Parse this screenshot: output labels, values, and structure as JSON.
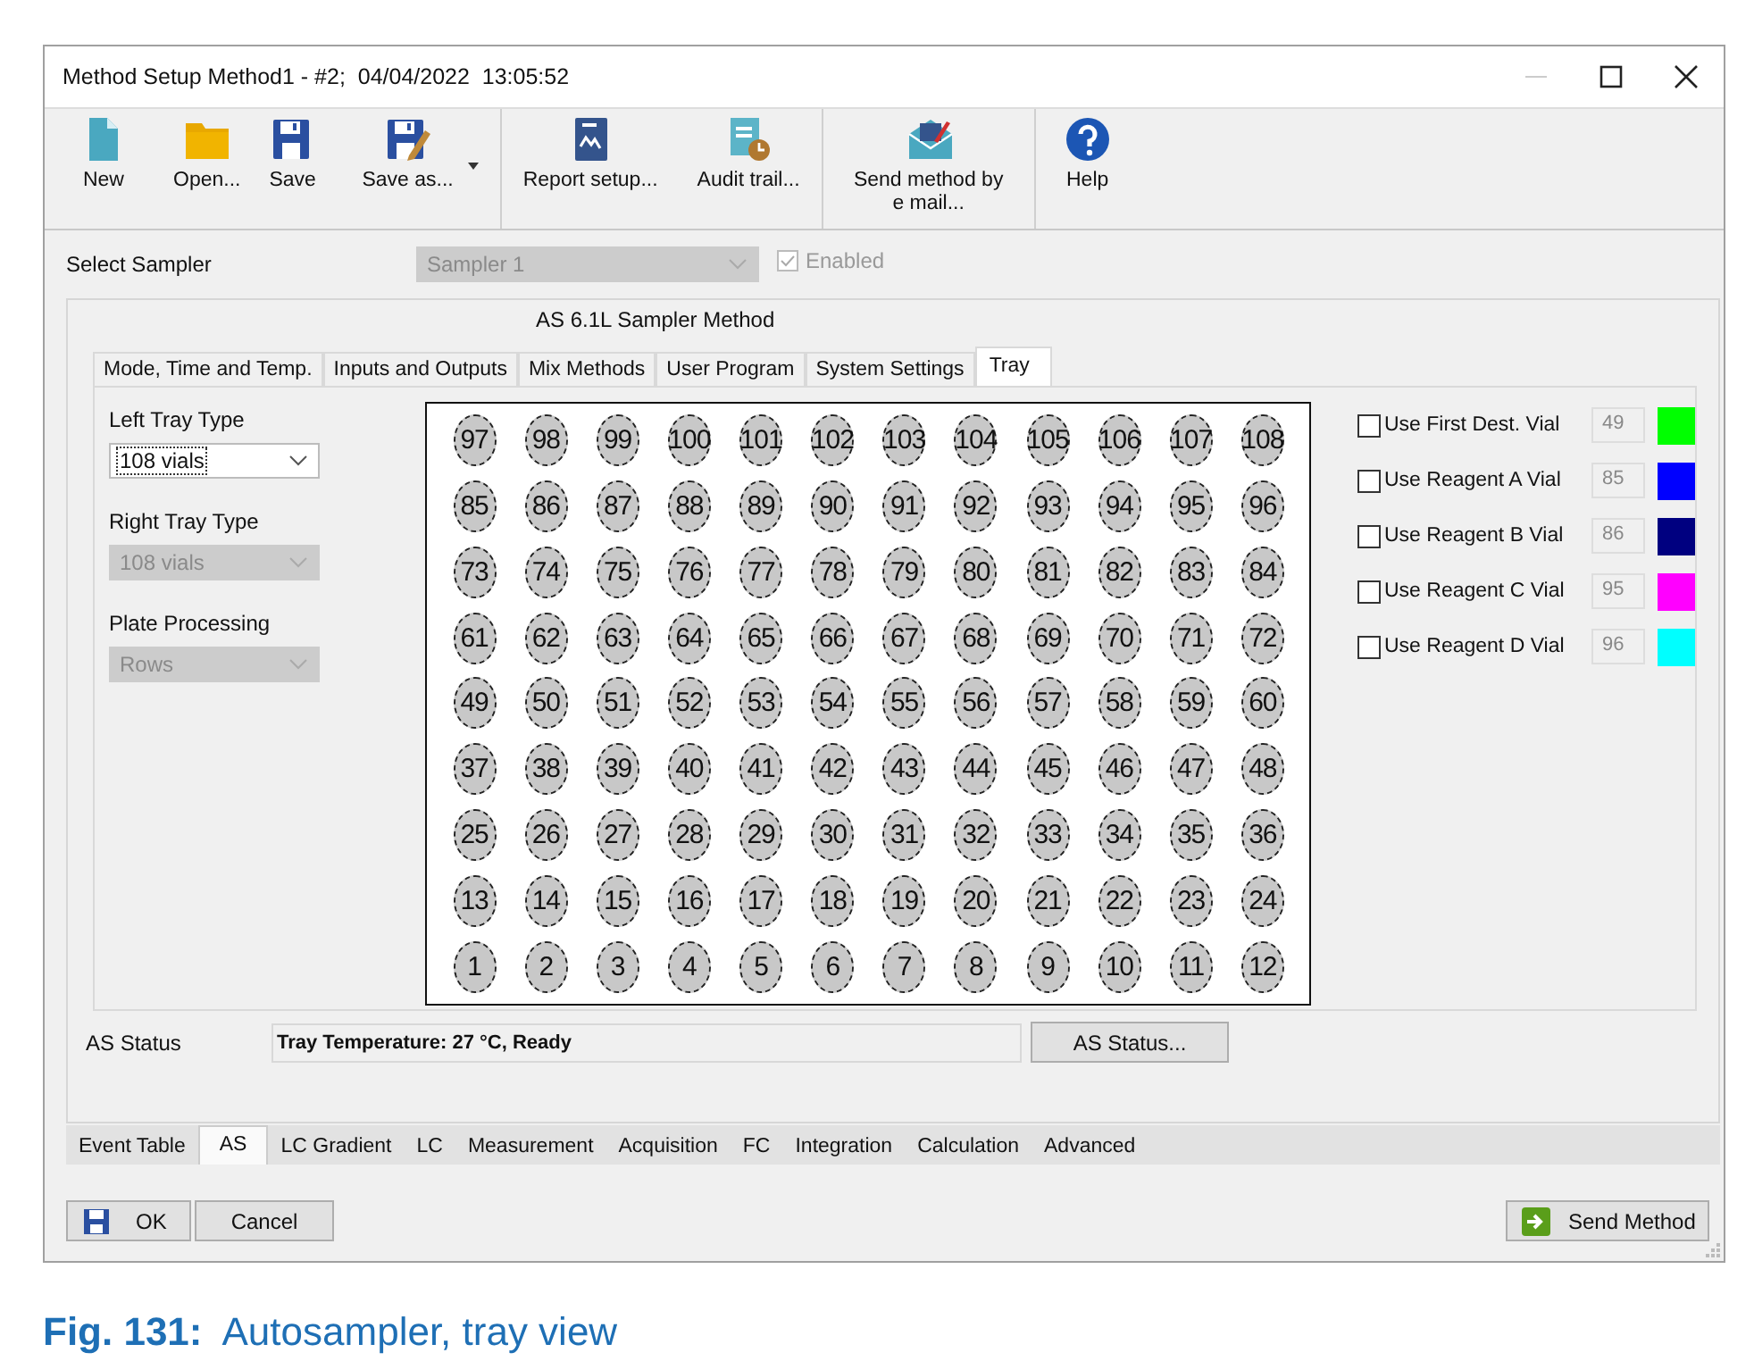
{
  "window": {
    "title": "Method Setup Method1 - #2;  04/04/2022  13:05:52"
  },
  "toolbar": {
    "groups": [
      [
        {
          "label": "New",
          "has_menu": false
        },
        {
          "label": "Open...",
          "has_menu": false
        },
        {
          "label": "Save",
          "has_menu": false
        },
        {
          "label": "Save as...",
          "has_menu": true
        }
      ],
      [
        {
          "label": "Report setup...",
          "has_menu": false
        },
        {
          "label": "Audit trail...",
          "has_menu": false
        }
      ],
      [
        {
          "label": "Send method by e mail...",
          "has_menu": false
        }
      ],
      [
        {
          "label": "Help",
          "has_menu": false
        }
      ]
    ]
  },
  "sampler": {
    "label": "Select Sampler",
    "value": "Sampler 1",
    "disabled": true,
    "enabled_checkbox": {
      "label": "Enabled",
      "checked": true,
      "disabled": true
    }
  },
  "panel": {
    "title": "AS 6.1L Sampler Method",
    "tabs": [
      {
        "label": "Mode, Time and Temp.",
        "selected": false
      },
      {
        "label": "Inputs and Outputs",
        "selected": false
      },
      {
        "label": "Mix Methods",
        "selected": false
      },
      {
        "label": "User Program",
        "selected": false
      },
      {
        "label": "System Settings",
        "selected": false
      },
      {
        "label": "Tray",
        "selected": true
      }
    ],
    "fields": [
      {
        "label": "Left Tray Type",
        "value": "108 vials",
        "disabled": false
      },
      {
        "label": "Right Tray Type",
        "value": "108 vials",
        "disabled": true
      },
      {
        "label": "Plate Processing",
        "value": "Rows",
        "disabled": true
      }
    ],
    "tray": {
      "rows": [
        [
          "97",
          "98",
          "99",
          "100",
          "101",
          "102",
          "103",
          "104",
          "105",
          "106",
          "107",
          "108"
        ],
        [
          "85",
          "86",
          "87",
          "88",
          "89",
          "90",
          "91",
          "92",
          "93",
          "94",
          "95",
          "96"
        ],
        [
          "73",
          "74",
          "75",
          "76",
          "77",
          "78",
          "79",
          "80",
          "81",
          "82",
          "83",
          "84"
        ],
        [
          "61",
          "62",
          "63",
          "64",
          "65",
          "66",
          "67",
          "68",
          "69",
          "70",
          "71",
          "72"
        ],
        [
          "49",
          "50",
          "51",
          "52",
          "53",
          "54",
          "55",
          "56",
          "57",
          "58",
          "59",
          "60"
        ],
        [
          "37",
          "38",
          "39",
          "40",
          "41",
          "42",
          "43",
          "44",
          "45",
          "46",
          "47",
          "48"
        ],
        [
          "25",
          "26",
          "27",
          "28",
          "29",
          "30",
          "31",
          "32",
          "33",
          "34",
          "35",
          "36"
        ],
        [
          "13",
          "14",
          "15",
          "16",
          "17",
          "18",
          "19",
          "20",
          "21",
          "22",
          "23",
          "24"
        ],
        [
          "1",
          "2",
          "3",
          "4",
          "5",
          "6",
          "7",
          "8",
          "9",
          "10",
          "11",
          "12"
        ]
      ]
    },
    "options": [
      {
        "label": "Use First Dest. Vial",
        "checked": false,
        "disabled": true,
        "value": "49",
        "color": "#00ff00"
      },
      {
        "label": "Use Reagent A Vial",
        "checked": false,
        "disabled": true,
        "value": "85",
        "color": "#0000ff"
      },
      {
        "label": "Use Reagent B Vial",
        "checked": false,
        "disabled": true,
        "value": "86",
        "color": "#000080"
      },
      {
        "label": "Use Reagent C Vial",
        "checked": false,
        "disabled": true,
        "value": "95",
        "color": "#ff00ff"
      },
      {
        "label": "Use Reagent D Vial",
        "checked": false,
        "disabled": true,
        "value": "96",
        "color": "#00ffff"
      }
    ],
    "status": {
      "label": "AS Status",
      "value": "Tray Temperature: 27 °C, Ready",
      "button": "AS Status..."
    }
  },
  "bottom_tabs": [
    {
      "label": "Event Table",
      "selected": false
    },
    {
      "label": "AS",
      "selected": true
    },
    {
      "label": "LC Gradient",
      "selected": false
    },
    {
      "label": "LC",
      "selected": false
    },
    {
      "label": "Measurement",
      "selected": false
    },
    {
      "label": "Acquisition",
      "selected": false
    },
    {
      "label": "FC",
      "selected": false
    },
    {
      "label": "Integration",
      "selected": false
    },
    {
      "label": "Calculation",
      "selected": false
    },
    {
      "label": "Advanced",
      "selected": false
    }
  ],
  "buttons": [
    {
      "label": "OK",
      "kind": "save"
    },
    {
      "label": "Cancel",
      "kind": "plain"
    },
    {
      "label": "Send Method",
      "kind": "send"
    }
  ],
  "caption": "**Fig. 131:**  Autosampler, tray view"
}
